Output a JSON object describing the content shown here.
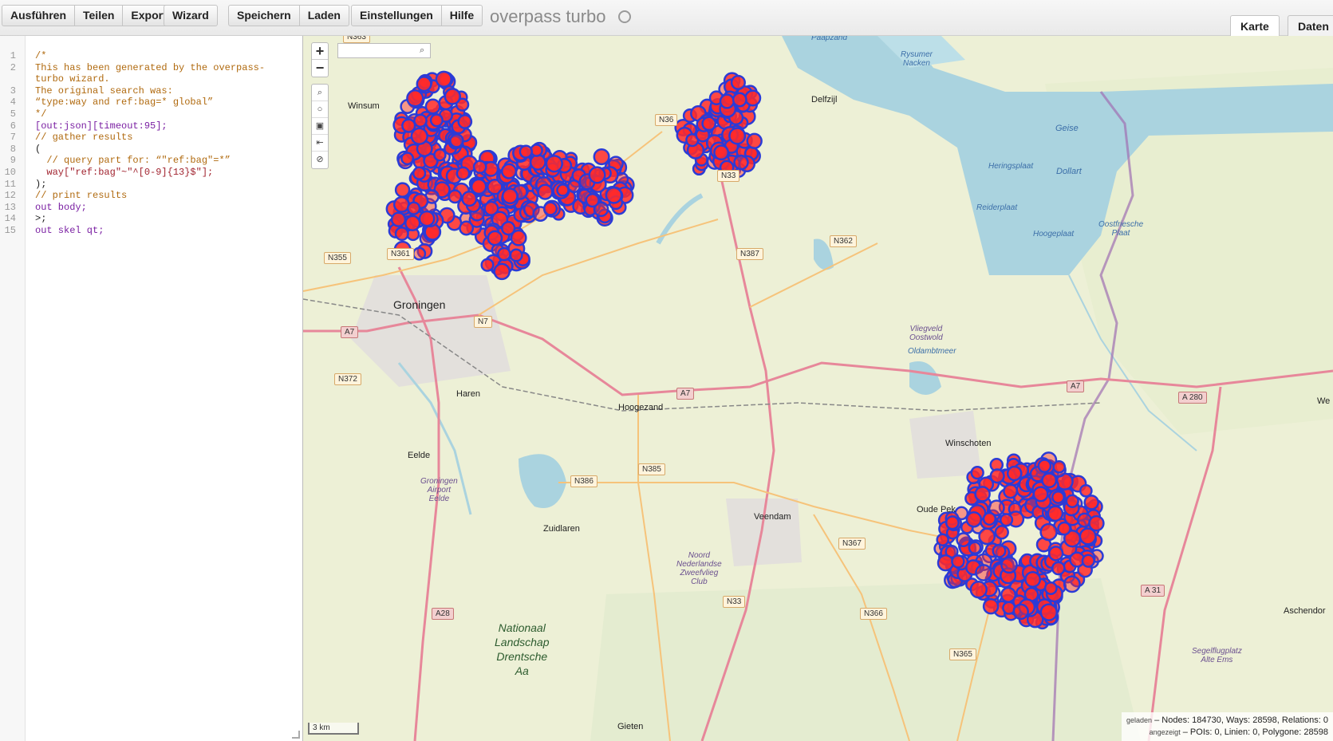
{
  "toolbar": {
    "run_label": "Ausführen",
    "share_label": "Teilen",
    "export_label": "Export",
    "wizard_label": "Wizard",
    "save_label": "Speichern",
    "load_label": "Laden",
    "settings_label": "Einstellungen",
    "help_label": "Hilfe",
    "app_title": "overpass turbo",
    "tab_map": "Karte",
    "tab_data": "Daten"
  },
  "editor": {
    "lines": [
      {
        "n": "1",
        "text": "/*",
        "cls": "c-comment"
      },
      {
        "n": "2",
        "text": "This has been generated by the overpass-",
        "cls": "c-comment"
      },
      {
        "n": "",
        "text": "turbo wizard.",
        "cls": "c-comment"
      },
      {
        "n": "3",
        "text": "The original search was:",
        "cls": "c-comment"
      },
      {
        "n": "4",
        "text": "“type:way and ref:bag=* global”",
        "cls": "c-comment"
      },
      {
        "n": "5",
        "text": "*/",
        "cls": "c-comment"
      },
      {
        "n": "6",
        "text": "[out:json][timeout:95];",
        "cls": "c-key"
      },
      {
        "n": "7",
        "text": "// gather results",
        "cls": "c-comment"
      },
      {
        "n": "8",
        "text": "(",
        "cls": "c-plain"
      },
      {
        "n": "9",
        "text": "  // query part for: “\"ref:bag\"=*”",
        "cls": "c-comment"
      },
      {
        "n": "10",
        "text": "  way[\"ref:bag\"~\"^[0-9]{13}$\"];",
        "cls": "c-str"
      },
      {
        "n": "11",
        "text": ");",
        "cls": "c-plain"
      },
      {
        "n": "12",
        "text": "// print results",
        "cls": "c-comment"
      },
      {
        "n": "13",
        "text": "out body;",
        "cls": "c-key"
      },
      {
        "n": "14",
        "text": ">;",
        "cls": "c-plain"
      },
      {
        "n": "15",
        "text": "out skel qt;",
        "cls": "c-key"
      }
    ]
  },
  "map": {
    "zoom_in": "+",
    "zoom_out": "−",
    "search_placeholder": "",
    "scale_label": "3 km",
    "stats_loaded_label": "geladen",
    "stats_loaded": " – Nodes: 184730, Ways: 28598, Relations: 0",
    "stats_shown_label": "angezeigt",
    "stats_shown": " – POIs: 0, Linien: 0, Polygone: 28598",
    "labels": {
      "groningen": "Groningen",
      "winsum": "Winsum",
      "delfzijl": "Delfzijl",
      "haren": "Haren",
      "eelde": "Eelde",
      "hoogezand": "Hoogezand",
      "winschoten": "Winschoten",
      "oude_pekela": "Oude Pek",
      "veendam": "Veendam",
      "zuidlaren": "Zuidlaren",
      "gieten": "Gieten",
      "aschendorf": "Aschendor",
      "we": "We",
      "rysumer": "Rysumer\nNacken",
      "geise": "Geise",
      "heringsplaat": "Heringsplaat",
      "dollart": "Dollart",
      "reiderplaat": "Reiderplaat",
      "hoogeplaat": "Hoogeplaat",
      "oostfriesche": "Oostfriesche\nPlaat",
      "oldambtmeer": "Oldambtmeer",
      "vliegveld": "Vliegveld\nOostwold",
      "airport": "Groningen\nAirport\nEelde",
      "zweefvlieg": "Noord\nNederlandse\nZweefvlieg\nClub",
      "nationaal": "Nationaal\nLandschap\nDrentsche\nAa",
      "segelflug": "Segelflugplatz\nAlte Ems",
      "paapsand": "Paapzand"
    },
    "shields": {
      "n363": "N363",
      "n355": "N355",
      "n361": "N361",
      "n7": "N7",
      "a7a": "A7",
      "n372": "N372",
      "a7b": "A7",
      "n33a": "N33",
      "n36": "N36",
      "n387": "N387",
      "n362": "N362",
      "n386": "N386",
      "n385": "N385",
      "n367": "N367",
      "n33b": "N33",
      "n366": "N366",
      "n365": "N365",
      "a28": "A28",
      "a7c": "A7",
      "a280": "A 280",
      "a31": "A 31"
    }
  },
  "colors": {
    "marker_fill": "#ff2a2a",
    "marker_stroke": "#2b3bd6",
    "water": "#aad3df",
    "road_primary": "#e7879a",
    "road_secondary": "#f6c37a",
    "border": "#a06fb2"
  }
}
